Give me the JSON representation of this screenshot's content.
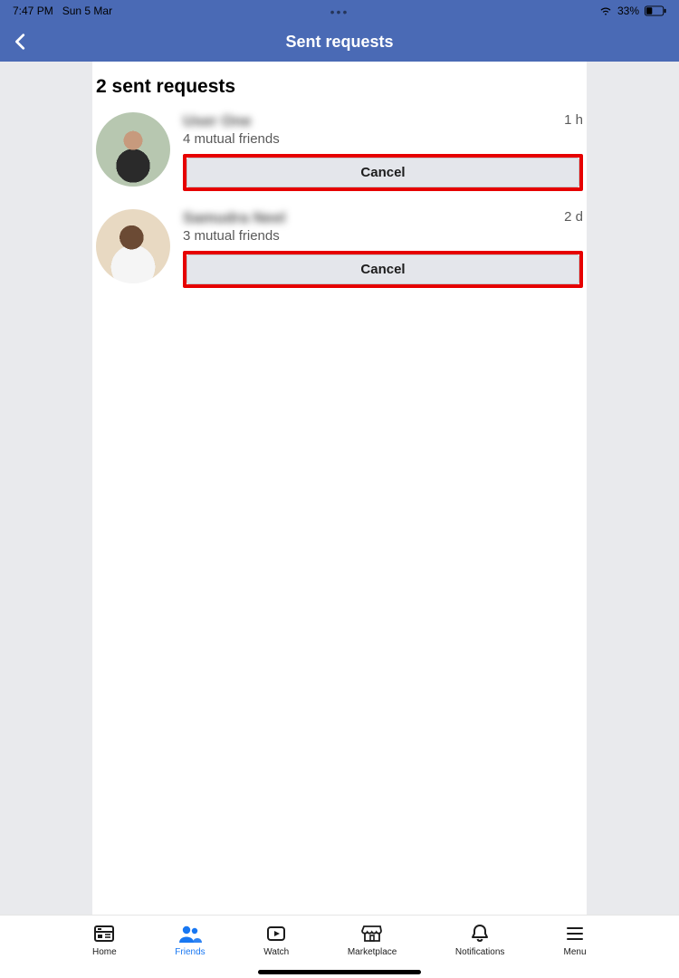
{
  "status": {
    "time": "7:47 PM",
    "date": "Sun 5 Mar",
    "battery_pct": "33%"
  },
  "header": {
    "title": "Sent requests"
  },
  "section_title": "2 sent requests",
  "requests": [
    {
      "name": "User One",
      "mutual": "4 mutual friends",
      "time": "1 h",
      "cancel_label": "Cancel"
    },
    {
      "name": "Samudra Neel",
      "mutual": "3 mutual friends",
      "time": "2 d",
      "cancel_label": "Cancel"
    }
  ],
  "tabs": {
    "home": "Home",
    "friends": "Friends",
    "watch": "Watch",
    "marketplace": "Marketplace",
    "notifications": "Notifications",
    "menu": "Menu"
  }
}
